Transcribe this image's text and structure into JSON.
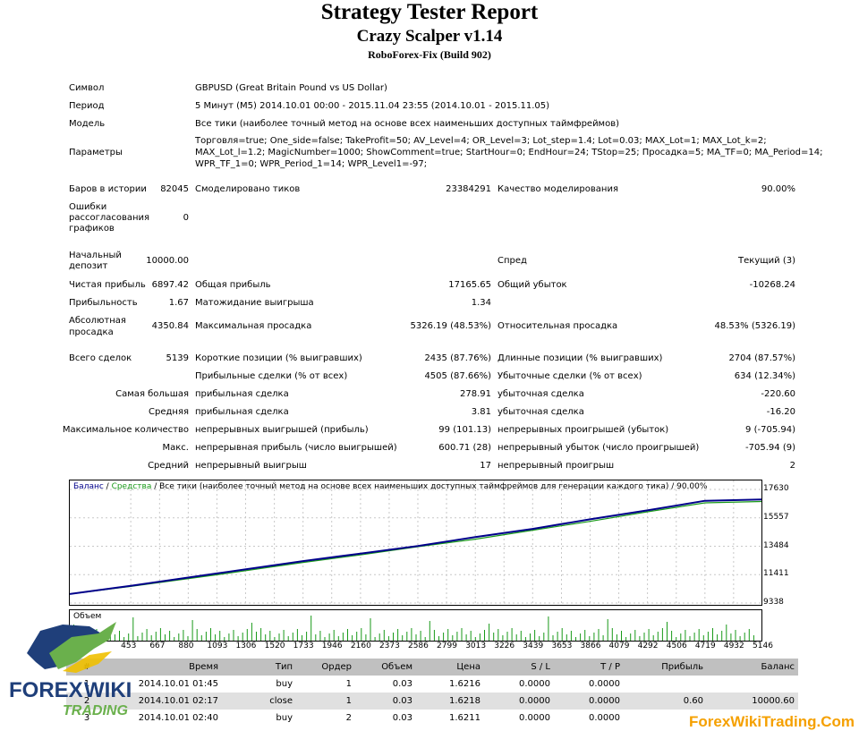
{
  "report": {
    "title": "Strategy Tester Report",
    "expert": "Crazy Scalper v1.14",
    "server": "RoboForex-Fix (Build 902)"
  },
  "summary": {
    "symbol_label": "Символ",
    "symbol_value": "GBPUSD (Great Britain Pound vs US Dollar)",
    "period_label": "Период",
    "period_value": "5 Минут (M5) 2014.10.01 00:00 - 2015.11.04 23:55 (2014.10.01 - 2015.11.05)",
    "model_label": "Модель",
    "model_value": "Все тики (наиболее точный метод на основе всех наименьших доступных таймфреймов)",
    "params_label": "Параметры",
    "params_line1": "Торговля=true; One_side=false; TakeProfit=50; AV_Level=4; OR_Level=3; Lot_step=1.4; Lot=0.03; MAX_Lot=1; MAX_Lot_k=2;",
    "params_line2": "MAX_Lot_l=1.2; MagicNumber=1000; ShowComment=true; StartHour=0; EndHour=24; TStop=25; Просадка=5; MA_TF=0; MA_Period=14;",
    "params_line3": "WPR_TF_1=0; WPR_Period_1=14; WPR_Level1=-97;",
    "bars_label": "Баров в истории",
    "bars_value": "82045",
    "ticks_label": "Смоделировано тиков",
    "ticks_value": "23384291",
    "quality_label": "Качество моделирования",
    "quality_value": "90.00%",
    "errors_label1": "Ошибки",
    "errors_label2": "рассогласования",
    "errors_label3": "графиков",
    "errors_value": "0",
    "deposit_label1": "Начальный",
    "deposit_label2": "депозит",
    "deposit_value": "10000.00",
    "spread_label": "Спред",
    "spread_value": "Текущий (3)",
    "net_label": "Чистая прибыль",
    "net_value": "6897.42",
    "gross_profit_label": "Общая прибыль",
    "gross_profit_value": "17165.65",
    "gross_loss_label": "Общий убыток",
    "gross_loss_value": "-10268.24",
    "pf_label": "Прибыльность",
    "pf_value": "1.67",
    "expected_label": "Матожидание выигрыша",
    "expected_value": "1.34",
    "abs_dd_label1": "Абсолютная",
    "abs_dd_label2": "просадка",
    "abs_dd_value": "4350.84",
    "max_dd_label": "Максимальная просадка",
    "max_dd_value": "5326.19 (48.53%)",
    "rel_dd_label": "Относительная просадка",
    "rel_dd_value": "48.53% (5326.19)",
    "total_label": "Всего сделок",
    "total_value": "5139",
    "short_label": "Короткие позиции (% выигравших)",
    "short_value": "2435 (87.76%)",
    "long_label": "Длинные позиции (% выигравших)",
    "long_value": "2704 (87.57%)",
    "profit_trades_label": "Прибыльные сделки (% от всех)",
    "profit_trades_value": "4505 (87.66%)",
    "loss_trades_label": "Убыточные сделки (% от всех)",
    "loss_trades_value": "634 (12.34%)",
    "largest_label": "Самая большая",
    "largest_profit_label": "прибыльная сделка",
    "largest_profit_value": "278.91",
    "largest_loss_label": "убыточная сделка",
    "largest_loss_value": "-220.60",
    "average_label": "Средняя",
    "average_profit_label": "прибыльная сделка",
    "average_profit_value": "3.81",
    "average_loss_label": "убыточная сделка",
    "average_loss_value": "-16.20",
    "max_count_label": "Максимальное количество",
    "cons_wins_label": "непрерывных выигрышей (прибыль)",
    "cons_wins_value": "99 (101.13)",
    "cons_losses_label": "непрерывных проигрышей (убыток)",
    "cons_losses_value": "9 (-705.94)",
    "max_label": "Макс.",
    "cons_profit_label": "непрерывная прибыль (число выигрышей)",
    "cons_profit_value": "600.71 (28)",
    "cons_loss_label": "непрерывный убыток (число проигрышей)",
    "cons_loss_value": "-705.94 (9)",
    "avg_label": "Средний",
    "avg_win_label": "непрерывный выигрыш",
    "avg_win_value": "17",
    "avg_loss_label": "непрерывный проигрыш",
    "avg_loss_value": "2"
  },
  "chart_header": {
    "balance": "Баланс",
    "sep1": " / ",
    "equity": "Средства",
    "rest": " / Все тики (наиболее точный метод на основе всех наименьших доступных таймфреймов для генерации каждого тика) / 90.00%"
  },
  "volume_label": "Объем",
  "colors": {
    "balance": "#00008b",
    "equity": "#1a9a1a",
    "volume": "#1a9a1a",
    "header_bg": "#c0c0c0",
    "alt_row": "#e0e0e0",
    "watermark": "#f5a000"
  },
  "chart_data": {
    "type": "line",
    "xlabel": "",
    "ylabel": "",
    "ylim": [
      9338,
      17630
    ],
    "y_ticks": [
      "17630",
      "15557",
      "13484",
      "11411",
      "9338"
    ],
    "x_ticks": [
      "453",
      "667",
      "880",
      "1093",
      "1306",
      "1520",
      "1733",
      "1946",
      "2160",
      "2373",
      "2586",
      "2799",
      "3013",
      "3226",
      "3439",
      "3653",
      "3866",
      "4079",
      "4292",
      "4506",
      "4719",
      "4932",
      "5146"
    ],
    "xlim": [
      0,
      5139
    ],
    "series": [
      {
        "name": "Баланс",
        "x": [
          0,
          453,
          1093,
          1733,
          2160,
          2586,
          3013,
          3439,
          3866,
          4292,
          4719,
          5139
        ],
        "values": [
          10000,
          10600,
          11500,
          12400,
          12950,
          13500,
          14150,
          14750,
          15450,
          16100,
          16800,
          16900
        ]
      },
      {
        "name": "Средства",
        "x": [
          0,
          453,
          1093,
          1733,
          2160,
          2586,
          3013,
          3439,
          3866,
          4292,
          4719,
          5139
        ],
        "values": [
          10000,
          10550,
          11400,
          12300,
          12850,
          13450,
          14000,
          14650,
          15300,
          16000,
          16650,
          16750
        ]
      }
    ]
  },
  "trades": {
    "headers": [
      "#",
      "Время",
      "Тип",
      "Ордер",
      "Объем",
      "Цена",
      "S / L",
      "T / P",
      "Прибыль",
      "Баланс"
    ],
    "rows": [
      [
        "1",
        "2014.10.01 01:45",
        "buy",
        "1",
        "0.03",
        "1.6216",
        "0.0000",
        "0.0000",
        "",
        ""
      ],
      [
        "2",
        "2014.10.01 02:17",
        "close",
        "1",
        "0.03",
        "1.6218",
        "0.0000",
        "0.0000",
        "0.60",
        "10000.60"
      ],
      [
        "3",
        "2014.10.01 02:40",
        "buy",
        "2",
        "0.03",
        "1.6211",
        "0.0000",
        "0.0000",
        "",
        ""
      ]
    ]
  },
  "logo": {
    "line1": "FOREX",
    "line2": "WIKI",
    "line3": "TRADING"
  },
  "watermark": "ForexWikiTrading.Com"
}
